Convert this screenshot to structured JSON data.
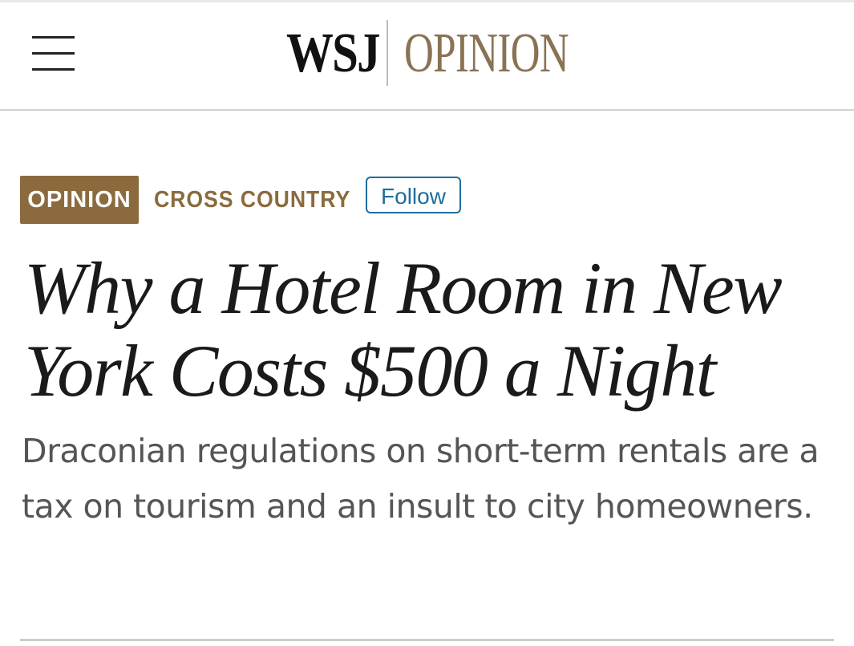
{
  "masthead": {
    "brand_primary": "WSJ",
    "brand_section": "OPINION",
    "menu_icon": "hamburger-menu-icon"
  },
  "article": {
    "section_badge": "OPINION",
    "column": "CROSS COUNTRY",
    "follow_label": "Follow",
    "headline": "Why a Hotel Room in New York Costs $500 a Night",
    "dek": "Draconian regulations on short-term rentals are a tax on tourism and an insult to city homeowners."
  },
  "colors": {
    "brand_gold": "#8a7254",
    "badge_brown": "#8b6b3e",
    "follow_blue": "#1e6e9c",
    "headline_text": "#1a1a1a",
    "dek_text": "#555555"
  }
}
